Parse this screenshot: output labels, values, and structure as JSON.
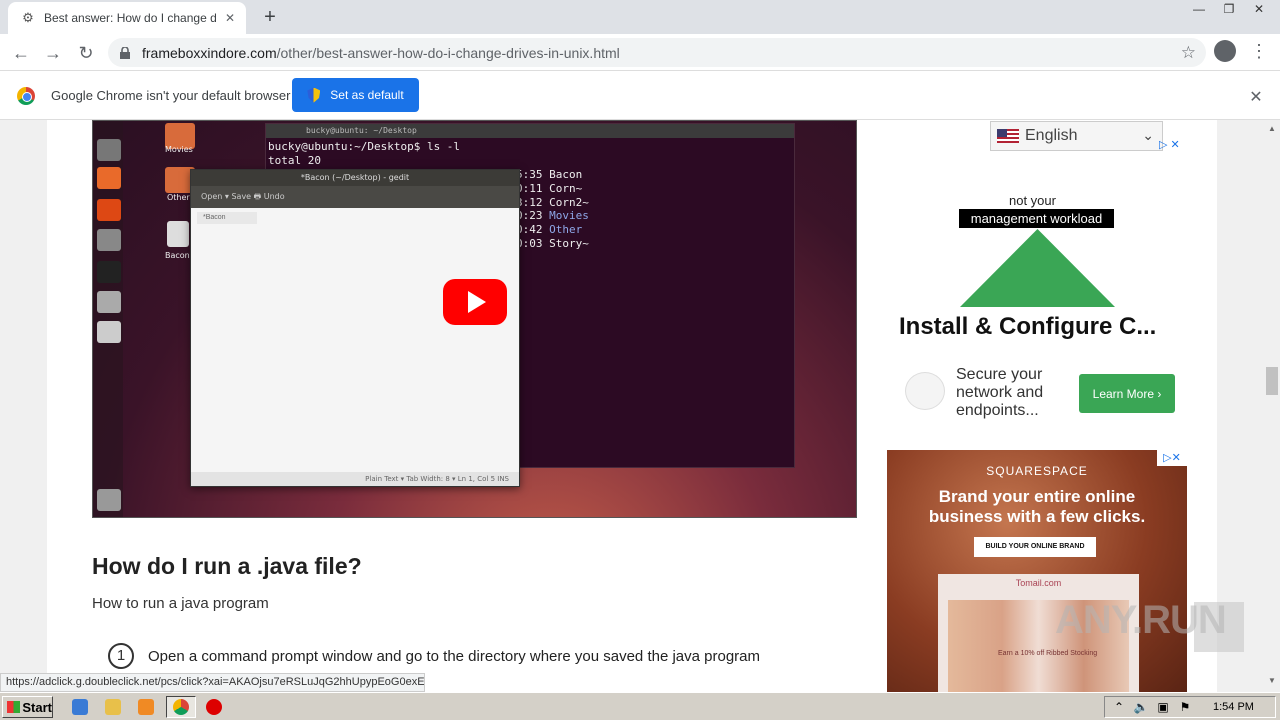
{
  "browser": {
    "tab_title": "Best answer: How do I change drive",
    "new_tab": "+",
    "url_host": "frameboxxindore.com",
    "url_path": "/other/best-answer-how-do-i-change-drives-in-unix.html",
    "window_controls": [
      "—",
      "❐",
      "✕"
    ]
  },
  "infobar": {
    "message": "Google Chrome isn't your default browser",
    "button": "Set as default",
    "close": "✕"
  },
  "video": {
    "terminal_title": "bucky@ubuntu: ~/Desktop",
    "terminal_lines": "bucky@ubuntu:~/Desktop$ ls -l\ntotal 20",
    "file_list": [
      {
        "time": "5:35",
        "name": "Bacon",
        "color": "#eeeeee"
      },
      {
        "time": "0:11",
        "name": "Corn~",
        "color": "#eeeeee"
      },
      {
        "time": "3:12",
        "name": "Corn2~",
        "color": "#eeeeee"
      },
      {
        "time": "0:23",
        "name": "Movies",
        "color": "#8fa8e8"
      },
      {
        "time": "0:42",
        "name": "Other",
        "color": "#8fa8e8"
      },
      {
        "time": "0:03",
        "name": "Story~",
        "color": "#eeeeee"
      }
    ],
    "gedit_title": "*Bacon (~/Desktop) - gedit",
    "gedit_toolbar": "Open ▾   Save   🖶   Undo",
    "gedit_tab": "*Bacon",
    "gedit_status": "Plain Text ▾    Tab Width: 8 ▾    Ln 1, Col 5    INS",
    "desktop_labels": [
      "Movies",
      "Other",
      "Bacon"
    ]
  },
  "article": {
    "heading": "How do I run a .java file?",
    "intro": "How to run a java program",
    "steps": [
      {
        "num": "1",
        "text": "Open a command prompt window and go to the directory where you saved the java program"
      }
    ]
  },
  "sidebar": {
    "language": "English",
    "ad1": {
      "not_your": "not your",
      "management": "management workload",
      "title": "Install & Configure C...",
      "subtitle": "Secure your network and endpoints...",
      "button": "Learn More ›"
    },
    "ad2": {
      "brand": "SQUARESPACE",
      "headline_line1": "Brand your entire online",
      "headline_line2": "business with a few clicks.",
      "button": "BUILD YOUR ONLINE BRAND",
      "card_brand": "Tomail.com",
      "card_text": "Earn a 10% off Ribbed Stocking"
    }
  },
  "status_bar_url": "https://adclick.g.doubleclick.net/pcs/click?xai=AKAOjsu7eRSLuJqG2hhUpypEoG0exE...",
  "watermark": "ANY.RUN",
  "taskbar": {
    "start": "Start",
    "clock": "1:54 PM"
  }
}
